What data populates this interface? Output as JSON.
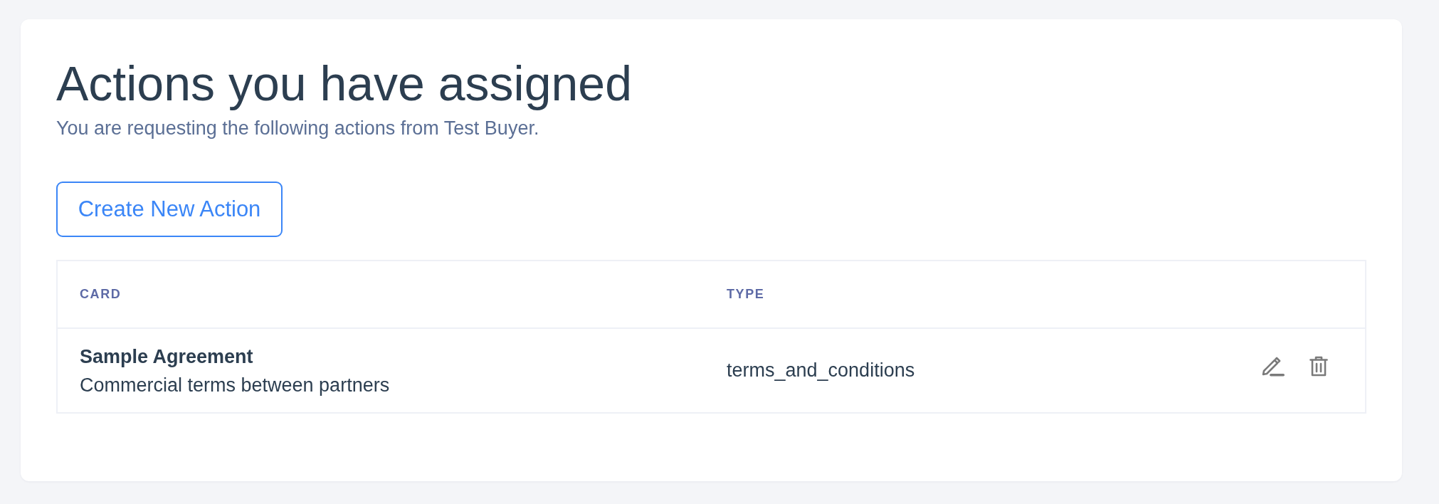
{
  "page": {
    "title": "Actions you have assigned",
    "subtitle": "You are requesting the following actions from Test Buyer."
  },
  "create_button": {
    "label": "Create New Action"
  },
  "table": {
    "columns": [
      "CARD",
      "TYPE"
    ],
    "rows": [
      {
        "card_title": "Sample Agreement",
        "card_description": "Commercial terms between partners",
        "type": "terms_and_conditions"
      }
    ]
  }
}
